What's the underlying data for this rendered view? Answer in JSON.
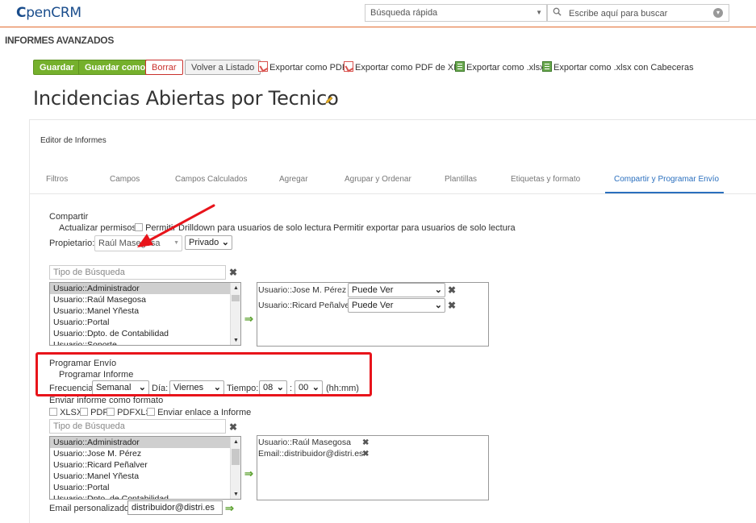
{
  "header": {
    "logo_c": "C",
    "logo_text": "penCRM",
    "quick_search_label": "Búsqueda rápida",
    "search_placeholder": "Escribe aquí para buscar"
  },
  "section_title": "INFORMES AVANZADOS",
  "toolbar": {
    "save": "Guardar",
    "save_as": "Guardar como",
    "delete": "Borrar",
    "back": "Volver a Listado",
    "export_pdf": "Exportar como PDF",
    "export_pdf_xls": "Exportar como PDF de XLS",
    "export_xlsx": "Exportar como .xlsx",
    "export_xlsx_headers": "Exportar como .xlsx con Cabeceras"
  },
  "report_title": "Incidencias Abiertas por Tecnico",
  "editor_label": "Editor de Informes",
  "tabs": [
    {
      "label": "Filtros"
    },
    {
      "label": "Campos"
    },
    {
      "label": "Campos Calculados"
    },
    {
      "label": "Agregar"
    },
    {
      "label": "Agrupar y Ordenar"
    },
    {
      "label": "Plantillas"
    },
    {
      "label": "Etiquetas y formato"
    },
    {
      "label": "Compartir y Programar Envío"
    }
  ],
  "share": {
    "heading": "Compartir",
    "update_permissions": "Actualizar permisos",
    "allow_drilldown": "Permitir Drilldown para usuarios de solo lectura",
    "allow_export": "Permitir exportar para usuarios de solo lectura",
    "owner_label": "Propietario:",
    "owner_value": "Raúl Masegosa",
    "privacy_value": "Privado",
    "search_type_placeholder": "Tipo de Búsqueda",
    "user_list": [
      "Usuario::Administrador",
      "Usuario::Raúl Masegosa",
      "Usuario::Manel Yñesta",
      "Usuario::Portal",
      "Usuario::Dpto. de Contabilidad",
      "Usuario::Soporte"
    ],
    "shared_with": [
      {
        "name": "Usuario::Jose M. Pérez",
        "perm": "Puede Ver"
      },
      {
        "name": "Usuario::Ricard Peñalver",
        "perm": "Puede Ver"
      }
    ]
  },
  "schedule": {
    "heading": "Programar Envío",
    "subheading": "Programar Informe",
    "frequency_label": "Frecuencia:",
    "frequency_value": "Semanal",
    "day_label": "Día:",
    "day_value": "Viernes",
    "time_label": "Tiempo:",
    "hour_value": "08",
    "colon": ":",
    "minute_value": "00",
    "time_hint": "(hh:mm)"
  },
  "send": {
    "heading": "Enviar informe como formato",
    "formats": [
      "XLSX",
      "PDF",
      "PDFXLS",
      "Enviar enlace a Informe"
    ],
    "search_type_placeholder": "Tipo de Búsqueda",
    "user_list": [
      "Usuario::Administrador",
      "Usuario::Jose M. Pérez",
      "Usuario::Ricard Peñalver",
      "Usuario::Manel Yñesta",
      "Usuario::Portal",
      "Usuario::Dpto. de Contabilidad"
    ],
    "recipients": [
      "Usuario::Raúl Masegosa",
      "Email::distribuidor@distri.es"
    ],
    "custom_email_label": "Email personalizado:",
    "custom_email_value": "distribuidor@distri.es"
  },
  "colors": {
    "accent": "#e26b2e",
    "green_button": "#75b02c",
    "active_tab": "#2a6fbe",
    "annotation": "#e8141b"
  }
}
